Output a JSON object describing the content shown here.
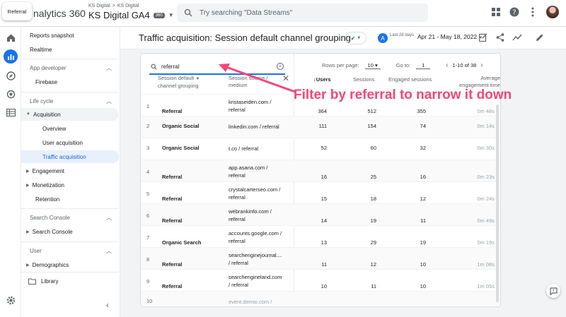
{
  "browser_tab": {
    "label": "Referral"
  },
  "app": {
    "product": "nalytics 360",
    "account_path": [
      "KS Digital",
      ">",
      "KS Digital"
    ],
    "property": "KS Digital GA4",
    "property_badge": "360",
    "search_placeholder": "Try searching \"Data Streams\""
  },
  "nav": {
    "reports_snapshot": "Reports snapshot",
    "realtime": "Realtime",
    "app_developer": "App developer",
    "firebase": "Firebase",
    "life_cycle": "Life cycle",
    "acquisition": "Acquisition",
    "overview": "Overview",
    "user_acquisition": "User acquisition",
    "traffic_acquisition": "Traffic acquisition",
    "engagement": "Engagement",
    "monetization": "Monetization",
    "retention": "Retention",
    "search_console_section": "Search Console",
    "search_console": "Search Console",
    "user_section": "User",
    "demographics": "Demographics",
    "library": "Library"
  },
  "page": {
    "title": "Traffic acquisition: Session default channel grouping",
    "date_avatar": "A",
    "date_label": "Last 28 days",
    "date_range": "Apr 21 - May 18, 2022"
  },
  "table": {
    "filter_value": "referral",
    "rows_per_page_label": "Rows per page:",
    "rows_per_page": "10",
    "goto_label": "Go to:",
    "goto_value": "1",
    "range_label": "1-10 of 38",
    "headers": {
      "dim1_line1": "Session default",
      "dim1_line2": "channel grouping",
      "dim2_line1": "Session source /",
      "dim2_line2": "medium",
      "users": "↓Users",
      "sessions": "Sessions",
      "engaged": "Engaged sessions",
      "avg_line1": "Average",
      "avg_line2": "engagement time"
    },
    "rows": [
      {
        "idx": "1",
        "group": "Referral",
        "src1": "kristaseiden.com /",
        "src2": "referral",
        "users": "364",
        "sessions": "512",
        "engaged": "355",
        "avg": "0m 48s"
      },
      {
        "idx": "2",
        "group": "Organic Social",
        "src1": "linkedin.com / referral",
        "src2": "",
        "users": "111",
        "sessions": "154",
        "engaged": "74",
        "avg": "0m 14s"
      },
      {
        "idx": "3",
        "group": "Organic Social",
        "src1": "t.co / referral",
        "src2": "",
        "users": "52",
        "sessions": "60",
        "engaged": "32",
        "avg": "0m 30s"
      },
      {
        "idx": "4",
        "group": "Referral",
        "src1": "app.asana.com /",
        "src2": "referral",
        "users": "16",
        "sessions": "25",
        "engaged": "16",
        "avg": "0m 23s"
      },
      {
        "idx": "5",
        "group": "Referral",
        "src1": "crystalcarterseo.com /",
        "src2": "referral",
        "users": "15",
        "sessions": "18",
        "engaged": "12",
        "avg": "0m 24s"
      },
      {
        "idx": "6",
        "group": "Referral",
        "src1": "webrankinfo.com /",
        "src2": "referral",
        "users": "14",
        "sessions": "19",
        "engaged": "11",
        "avg": "0m 49s"
      },
      {
        "idx": "7",
        "group": "Organic Search",
        "src1": "accounts.google.com /",
        "src2": "referral",
        "users": "13",
        "sessions": "29",
        "engaged": "19",
        "avg": "0m 19s"
      },
      {
        "idx": "8",
        "group": "Referral",
        "src1": "searchenginejournal....",
        "src2": "/ referral",
        "users": "11",
        "sessions": "12",
        "engaged": "10",
        "avg": "1m 08s"
      },
      {
        "idx": "9",
        "group": "Referral",
        "src1": "searchengineland.com",
        "src2": "/ referral",
        "users": "10",
        "sessions": "11",
        "engaged": "10",
        "avg": "1m 05s"
      },
      {
        "idx": "10",
        "group": "",
        "src1": "event.demio.com /",
        "src2": "",
        "users": "",
        "sessions": "",
        "engaged": "",
        "avg": ""
      }
    ]
  },
  "annotation": {
    "text": "Filter by referral to narrow it down",
    "color": "#f0487a"
  }
}
